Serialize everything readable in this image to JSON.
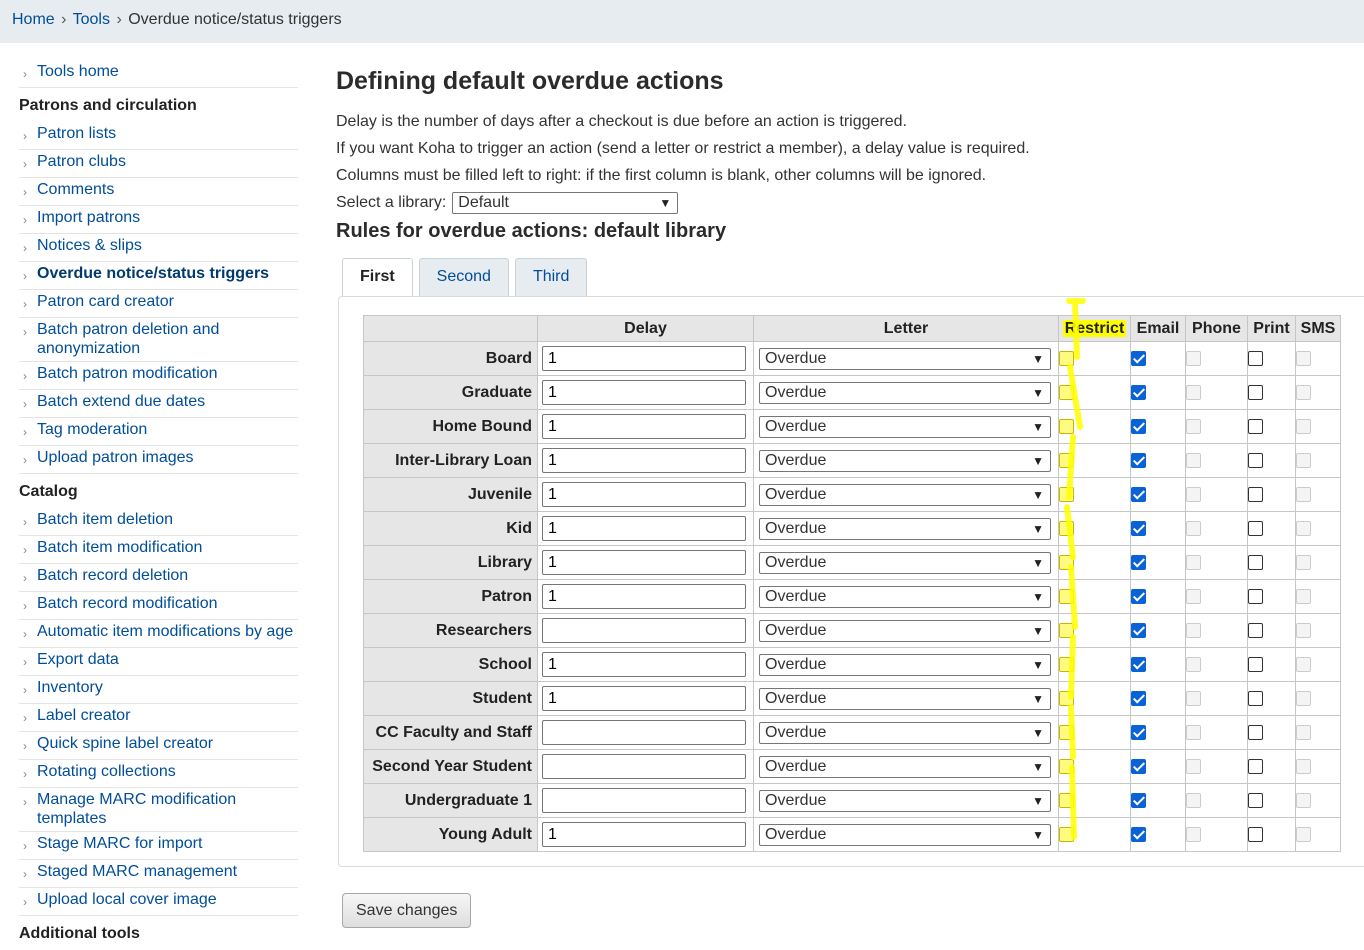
{
  "breadcrumb": {
    "home": "Home",
    "tools": "Tools",
    "current": "Overdue notice/status triggers",
    "sep": "›"
  },
  "sidebar": {
    "tools_home": "Tools home",
    "patrons_heading": "Patrons and circulation",
    "patrons_items": [
      "Patron lists",
      "Patron clubs",
      "Comments",
      "Import patrons",
      "Notices & slips",
      "Overdue notice/status triggers",
      "Patron card creator",
      "Batch patron deletion and anonymization",
      "Batch patron modification",
      "Batch extend due dates",
      "Tag moderation",
      "Upload patron images"
    ],
    "catalog_heading": "Catalog",
    "catalog_items": [
      "Batch item deletion",
      "Batch item modification",
      "Batch record deletion",
      "Batch record modification",
      "Automatic item modifications by age",
      "Export data",
      "Inventory",
      "Label creator",
      "Quick spine label creator",
      "Rotating collections",
      "Manage MARC modification templates",
      "Stage MARC for import",
      "Staged MARC management",
      "Upload local cover image"
    ],
    "additional_heading": "Additional tools"
  },
  "main": {
    "title": "Defining default overdue actions",
    "help1": "Delay is the number of days after a checkout is due before an action is triggered.",
    "help2": "If you want Koha to trigger an action (send a letter or restrict a member), a delay value is required.",
    "help3": "Columns must be filled left to right: if the first column is blank, other columns will be ignored.",
    "library_label": "Select a library:",
    "library_value": "Default",
    "rules_title": "Rules for overdue actions: default library",
    "tabs": [
      "First",
      "Second",
      "Third"
    ],
    "columns": [
      "Delay",
      "Letter",
      "Restrict",
      "Email",
      "Phone",
      "Print",
      "SMS"
    ],
    "rows": [
      {
        "category": "Board",
        "delay": "1",
        "letter": "Overdue"
      },
      {
        "category": "Graduate",
        "delay": "1",
        "letter": "Overdue"
      },
      {
        "category": "Home Bound",
        "delay": "1",
        "letter": "Overdue"
      },
      {
        "category": "Inter-Library Loan",
        "delay": "1",
        "letter": "Overdue"
      },
      {
        "category": "Juvenile",
        "delay": "1",
        "letter": "Overdue"
      },
      {
        "category": "Kid",
        "delay": "1",
        "letter": "Overdue"
      },
      {
        "category": "Library",
        "delay": "1",
        "letter": "Overdue"
      },
      {
        "category": "Patron",
        "delay": "1",
        "letter": "Overdue"
      },
      {
        "category": "Researchers",
        "delay": "",
        "letter": "Overdue"
      },
      {
        "category": "School",
        "delay": "1",
        "letter": "Overdue"
      },
      {
        "category": "Student",
        "delay": "1",
        "letter": "Overdue"
      },
      {
        "category": "CC Faculty and Staff",
        "delay": "",
        "letter": "Overdue"
      },
      {
        "category": "Second Year Student",
        "delay": "",
        "letter": "Overdue"
      },
      {
        "category": "Undergraduate 1",
        "delay": "",
        "letter": "Overdue"
      },
      {
        "category": "Young Adult",
        "delay": "1",
        "letter": "Overdue"
      }
    ],
    "save_label": "Save changes"
  },
  "colors": {
    "link": "#004d99",
    "highlight": "#ffff00",
    "checkbox": "#0a63d6"
  }
}
